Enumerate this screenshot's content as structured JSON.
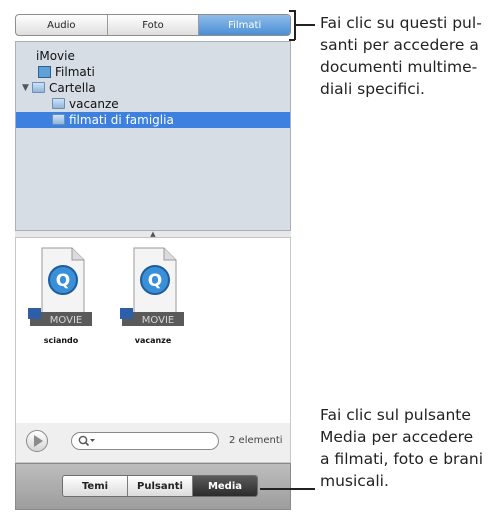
{
  "top_tabs": [
    {
      "label": "Audio",
      "active": false
    },
    {
      "label": "Foto",
      "active": false
    },
    {
      "label": "Filmati",
      "active": true
    }
  ],
  "tree": {
    "root": "iMovie",
    "items": [
      {
        "label": "Filmati",
        "icon": "film-icon"
      },
      {
        "label": "Cartella",
        "icon": "folder-icon",
        "expanded": true
      },
      {
        "label": "vacanze",
        "icon": "folder-icon"
      },
      {
        "label": "filmati di famiglia",
        "icon": "folder-icon",
        "selected": true
      }
    ]
  },
  "clips": [
    {
      "name": "sciando",
      "badge": "MOVIE"
    },
    {
      "name": "vacanze",
      "badge": "MOVIE"
    }
  ],
  "search": {
    "placeholder": ""
  },
  "status": {
    "count": "2 elementi"
  },
  "bottom_tabs": [
    {
      "label": "Temi",
      "active": false
    },
    {
      "label": "Pulsanti",
      "active": false
    },
    {
      "label": "Media",
      "active": true
    }
  ],
  "callouts": {
    "top": [
      "Fai clic su questi pul-",
      "santi per accedere a",
      "documenti multime-",
      "diali specifici."
    ],
    "bottom": [
      "Fai clic sul pulsante",
      "Media per accedere",
      "a filmati, foto e brani",
      "musicali."
    ]
  },
  "colors": {
    "selection": "#3d80df",
    "tree_bg": "#d7dde5",
    "active_tab": "#4a8fd6"
  }
}
